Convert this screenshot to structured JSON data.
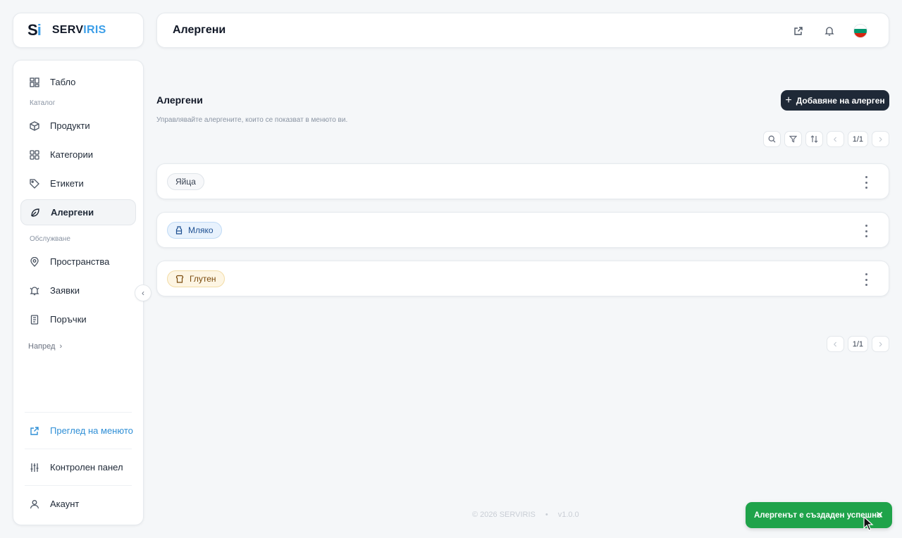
{
  "brand": {
    "mark_s": "S",
    "mark_i": "i",
    "name_a": "SERV",
    "name_b": "IRIS"
  },
  "sidebar": {
    "items": [
      {
        "label": "Табло",
        "icon": "dashboard-icon"
      },
      {
        "section": "Каталог"
      },
      {
        "label": "Продукти",
        "icon": "box-icon"
      },
      {
        "label": "Категории",
        "icon": "grid-icon"
      },
      {
        "label": "Етикети",
        "icon": "tag-icon"
      },
      {
        "label": "Алергени",
        "icon": "leaf-icon",
        "active": true
      },
      {
        "section": "Обслужване"
      },
      {
        "label": "Пространства",
        "icon": "location-pin-icon"
      },
      {
        "label": "Заявки",
        "icon": "bell-ring-icon"
      },
      {
        "label": "Поръчки",
        "icon": "receipt-icon"
      }
    ],
    "more_label": "Напред",
    "bottom": {
      "preview_label": "Преглед на менюто",
      "control_label": "Контролен панел",
      "account_label": "Акаунт"
    }
  },
  "header": {
    "title": "Алергени"
  },
  "page": {
    "title": "Алергени",
    "subtitle": "Управлявайте алергените, които се показват в менюто ви.",
    "add_button": "Добавяне на алерген",
    "pagination": "1/1"
  },
  "allergens": [
    {
      "label": "Яйца",
      "style": "gray",
      "icon": ""
    },
    {
      "label": "Мляко",
      "style": "blue",
      "icon": "milk-bottle-icon"
    },
    {
      "label": "Глутен",
      "style": "amber",
      "icon": "bread-icon"
    }
  ],
  "footer": {
    "copyright": "© 2026 SERVIRIS",
    "version": "v1.0.0"
  },
  "toast": {
    "message": "Алергенът е създаден успешно",
    "color": "#1fa34a"
  },
  "colors": {
    "accent": "#3b9ee8",
    "primary_button": "#1f2937"
  }
}
